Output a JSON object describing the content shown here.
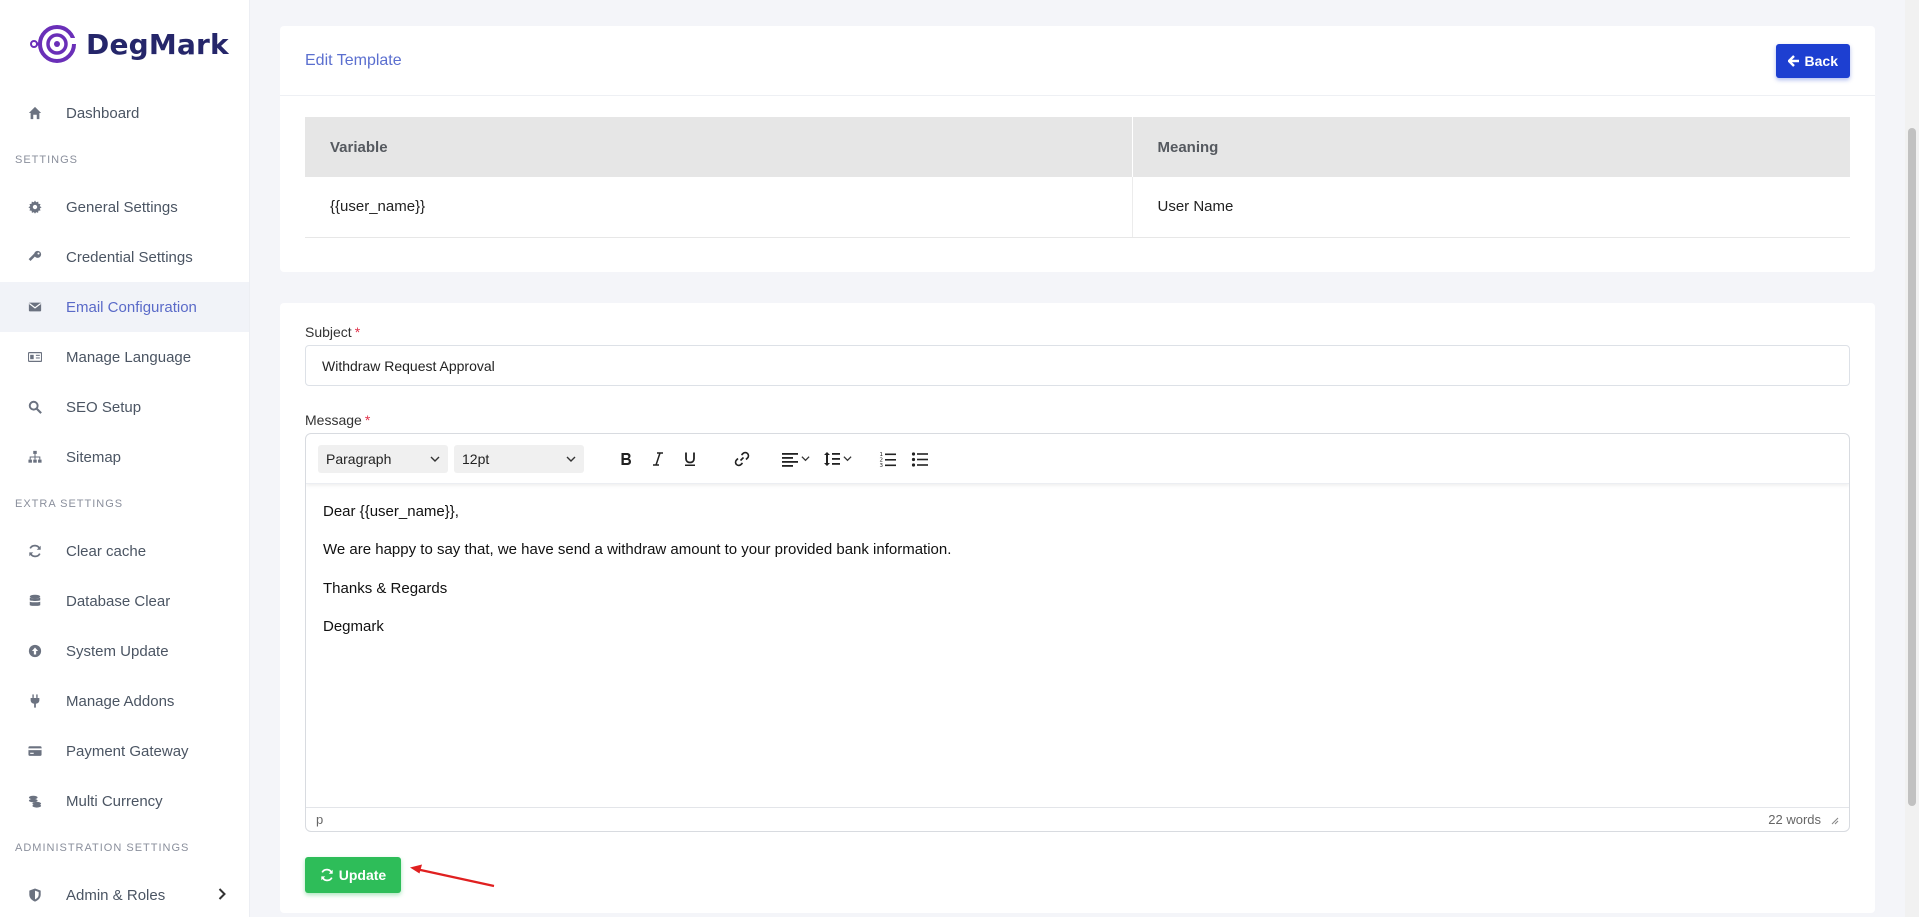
{
  "brand": {
    "name": "DegMark",
    "color": "#25266a",
    "accent": "#6a2fb8"
  },
  "sidebar": {
    "items_top": [
      {
        "label": "Dashboard",
        "icon": "home-icon"
      }
    ],
    "settings_title": "SETTINGS",
    "settings": [
      {
        "label": "General Settings",
        "icon": "gear-icon"
      },
      {
        "label": "Credential Settings",
        "icon": "key-icon"
      },
      {
        "label": "Email Configuration",
        "icon": "envelope-icon",
        "active": true
      },
      {
        "label": "Manage Language",
        "icon": "language-icon"
      },
      {
        "label": "SEO Setup",
        "icon": "search-icon"
      },
      {
        "label": "Sitemap",
        "icon": "sitemap-icon"
      }
    ],
    "extra_title": "EXTRA SETTINGS",
    "extra": [
      {
        "label": "Clear cache",
        "icon": "refresh-icon"
      },
      {
        "label": "Database Clear",
        "icon": "database-icon"
      },
      {
        "label": "System Update",
        "icon": "upload-icon"
      },
      {
        "label": "Manage Addons",
        "icon": "plug-icon"
      },
      {
        "label": "Payment Gateway",
        "icon": "credit-card-icon"
      },
      {
        "label": "Multi Currency",
        "icon": "coins-icon"
      }
    ],
    "admin_title": "ADMINISTRATION SETTINGS",
    "admin": [
      {
        "label": "Admin & Roles",
        "icon": "shield-icon"
      }
    ]
  },
  "template_card": {
    "title": "Edit Template",
    "back_label": "Back",
    "table": {
      "headers": [
        "Variable",
        "Meaning"
      ],
      "rows": [
        [
          "{{user_name}}",
          "User Name"
        ]
      ]
    }
  },
  "form": {
    "subject_label": "Subject",
    "required_mark": "*",
    "subject_value": "Withdraw Request Approval",
    "message_label": "Message",
    "editor": {
      "block_format": "Paragraph",
      "font_size": "12pt",
      "content": [
        "Dear {{user_name}},",
        "We are happy to say that, we have send a withdraw amount to your provided bank information.",
        "Thanks & Regards",
        "Degmark"
      ],
      "status_path": "p",
      "word_count": "22 words"
    },
    "update_label": "Update"
  },
  "colors": {
    "primary_button": "#1d3fd1",
    "success_button": "#2ebd59",
    "link_blue": "#5b6fcf",
    "arrow_red": "#e02020"
  }
}
